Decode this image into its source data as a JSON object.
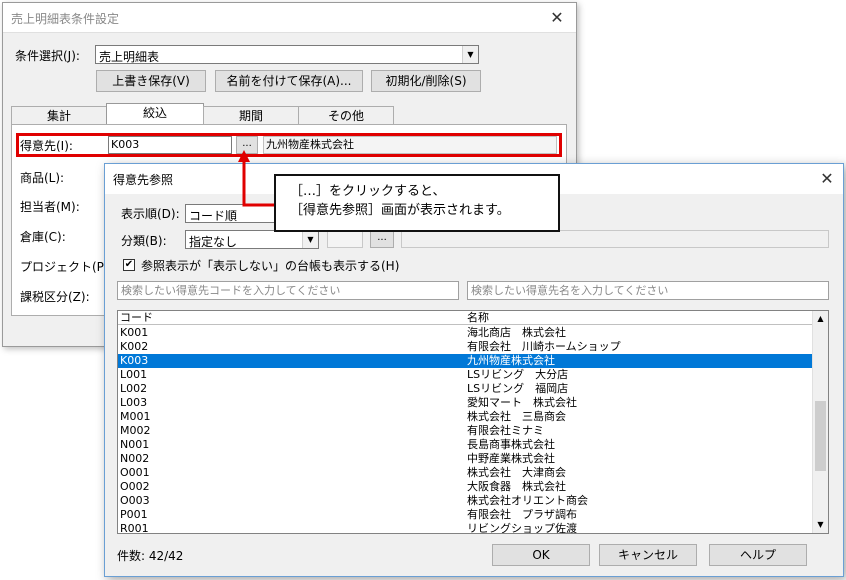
{
  "back_window": {
    "title": "売上明細表条件設定",
    "condition_label": "条件選択(J):",
    "condition_value": "売上明細表",
    "buttons": {
      "overwrite_save": "上書き保存(V)",
      "save_as": "名前を付けて保存(A)...",
      "init_delete": "初期化/削除(S)"
    },
    "tabs": [
      "集計",
      "絞込",
      "期間",
      "その他"
    ],
    "active_tab": "絞込",
    "fields": {
      "customer_label": "得意先(I):",
      "customer_code": "K003",
      "customer_ellipsis": "...",
      "customer_name": "九州物産株式会社",
      "product_label": "商品(L):",
      "staff_label": "担当者(M):",
      "warehouse_label": "倉庫(C):",
      "project_label": "プロジェクト(P):",
      "tax_label": "課税区分(Z):"
    }
  },
  "dialog": {
    "title": "得意先参照",
    "order_label": "表示順(D):",
    "order_value": "コード順",
    "category_label": "分類(B):",
    "category_value": "指定なし",
    "category_ellipsis": "...",
    "checkbox_label": "参照表示が「表示しない」の台帳も表示する(H)",
    "checkbox_checked": true,
    "search_code_placeholder": "検索したい得意先コードを入力してください",
    "search_name_placeholder": "検索したい得意先名を入力してください",
    "list_headers": {
      "code": "コード",
      "name": "名称"
    },
    "rows": [
      {
        "code": "K001",
        "name": "海北商店　株式会社"
      },
      {
        "code": "K002",
        "name": "有限会社　川崎ホームショップ"
      },
      {
        "code": "K003",
        "name": "九州物産株式会社",
        "selected": true
      },
      {
        "code": "L001",
        "name": "LSリビング　大分店"
      },
      {
        "code": "L002",
        "name": "LSリビング　福岡店"
      },
      {
        "code": "L003",
        "name": "愛知マート　株式会社"
      },
      {
        "code": "M001",
        "name": "株式会社　三島商会"
      },
      {
        "code": "M002",
        "name": "有限会社ミナミ"
      },
      {
        "code": "N001",
        "name": "長島商事株式会社"
      },
      {
        "code": "N002",
        "name": "中野産業株式会社"
      },
      {
        "code": "O001",
        "name": "株式会社　大津商会"
      },
      {
        "code": "O002",
        "name": "大阪食器　株式会社"
      },
      {
        "code": "O003",
        "name": "株式会社オリエント商会"
      },
      {
        "code": "P001",
        "name": "有限会社　プラザ調布"
      },
      {
        "code": "R001",
        "name": "リビングショップ佐渡"
      }
    ],
    "count_text": "件数: 42/42",
    "buttons": {
      "ok": "OK",
      "cancel": "キャンセル",
      "help": "ヘルプ"
    }
  },
  "callout": {
    "line1": "［…］をクリックすると、",
    "line2": "［得意先参照］画面が表示されます。"
  },
  "colors": {
    "highlight_red": "#e00000",
    "selection_blue": "#0078d7"
  }
}
